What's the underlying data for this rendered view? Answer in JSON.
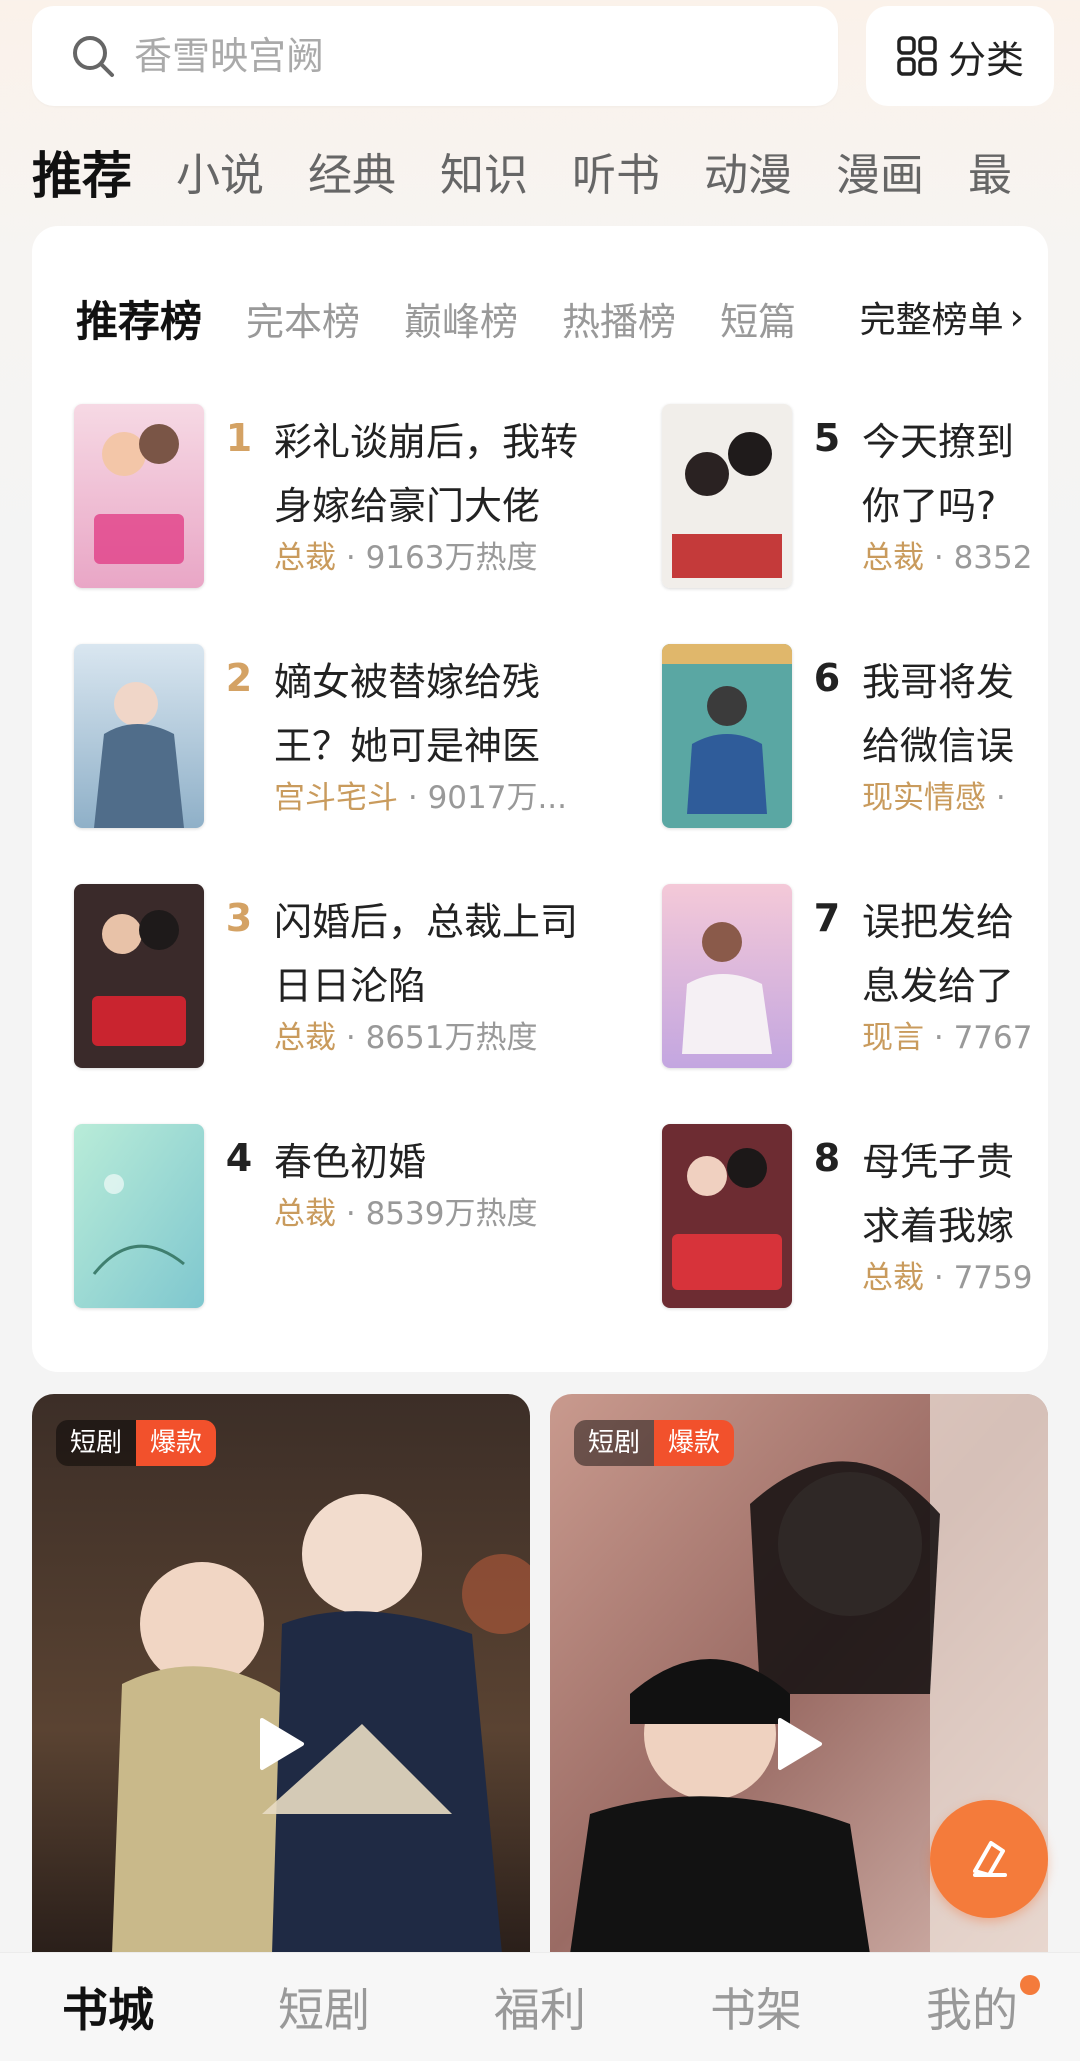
{
  "search": {
    "placeholder": "香雪映宫阙",
    "category_label": "分类"
  },
  "channel_tabs": [
    "推荐",
    "小说",
    "经典",
    "知识",
    "听书",
    "动漫",
    "漫画",
    "最"
  ],
  "rank_card": {
    "tabs": [
      "推荐榜",
      "完本榜",
      "巅峰榜",
      "热播榜",
      "短篇"
    ],
    "full_list_label": "完整榜单",
    "books": [
      {
        "rank": "1",
        "title": "彩礼谈崩后，我转身嫁给豪门大佬",
        "tag": "总裁",
        "heat": "9163万热度"
      },
      {
        "rank": "2",
        "title": "嫡女被替嫁给残王？她可是神医",
        "tag": "宫斗宅斗",
        "heat": "9017万..."
      },
      {
        "rank": "3",
        "title": "闪婚后，总裁上司日日沦陷",
        "tag": "总裁",
        "heat": "8651万热度"
      },
      {
        "rank": "4",
        "title": "春色初婚",
        "tag": "总裁",
        "heat": "8539万热度"
      },
      {
        "rank": "5",
        "title": "今天撩到你了吗?",
        "tag": "总裁",
        "heat": "8352"
      },
      {
        "rank": "6",
        "title": "我哥将发给微信误发给",
        "tag": "现实情感",
        "heat": ""
      },
      {
        "rank": "7",
        "title": "误把发给息发给了",
        "tag": "现言",
        "heat": "7767"
      },
      {
        "rank": "8",
        "title": "母凭子贵求着我嫁",
        "tag": "总裁",
        "heat": "7759"
      }
    ]
  },
  "dramas": [
    {
      "badge_type": "短剧",
      "badge_hot": "爆款"
    },
    {
      "badge_type": "短剧",
      "badge_hot": "爆款"
    }
  ],
  "bottom_nav": [
    "书城",
    "短剧",
    "福利",
    "书架",
    "我的"
  ],
  "colors": {
    "accent": "#f47b3b",
    "rank_gold": "#d4a264",
    "tag": "#c99b5d",
    "hot_badge": "#f2512c"
  }
}
